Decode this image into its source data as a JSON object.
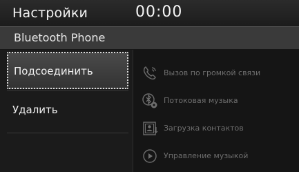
{
  "header": {
    "title": "Настройки",
    "clock": "00:00"
  },
  "subheader": {
    "title": "Bluetooth Phone"
  },
  "menu": {
    "items": [
      {
        "label": "Подсоединить",
        "selected": true
      },
      {
        "label": "Удалить",
        "selected": false
      }
    ]
  },
  "features": [
    {
      "label": "Вызов по громкой связи",
      "icon": "phone-handset-icon"
    },
    {
      "label": "Потоковая музыка",
      "icon": "bluetooth-audio-icon"
    },
    {
      "label": "Загрузка контактов",
      "icon": "contacts-download-icon"
    },
    {
      "label": "Управление музыкой",
      "icon": "play-circle-icon"
    }
  ],
  "colors": {
    "background": "#1e1e1e",
    "text_active": "#f0f0f0",
    "text_disabled": "#6e6e6e",
    "selection_border": "#d8d8d8"
  }
}
